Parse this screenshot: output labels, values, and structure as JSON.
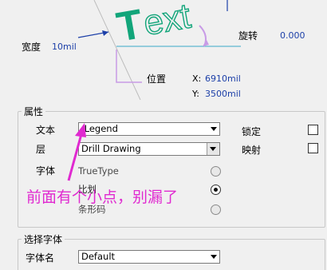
{
  "diagram": {
    "big_letter": "T",
    "outline_text": "ext",
    "width_label": "宽度",
    "width_value": "10mil",
    "rotation_label": "旋转",
    "rotation_value": "0.000",
    "position_label": "位置",
    "x_label": "X:",
    "x_value": "6910mil",
    "y_label": "Y:",
    "y_value": "3500mil"
  },
  "properties": {
    "title": "属性",
    "text_label": "文本",
    "text_value": ".Legend",
    "layer_label": "层",
    "layer_value": "Drill Drawing",
    "lock_label": "锁定",
    "mirror_label": "映射",
    "font_label": "字体",
    "font_options": [
      "TrueType",
      "比划",
      "条形码"
    ],
    "selected_font_option": "比划"
  },
  "annotation": {
    "text": "前面有个小点，别漏了",
    "color": "#e02ad0"
  },
  "font_select": {
    "title": "选择字体",
    "font_name_label": "字体名",
    "font_name_value": "Default"
  },
  "colors": {
    "value_blue": "#1c3fa8",
    "letter_green": "#12a57a",
    "guide_cyan": "#3aa8c8",
    "guide_purple": "#c89be6"
  }
}
